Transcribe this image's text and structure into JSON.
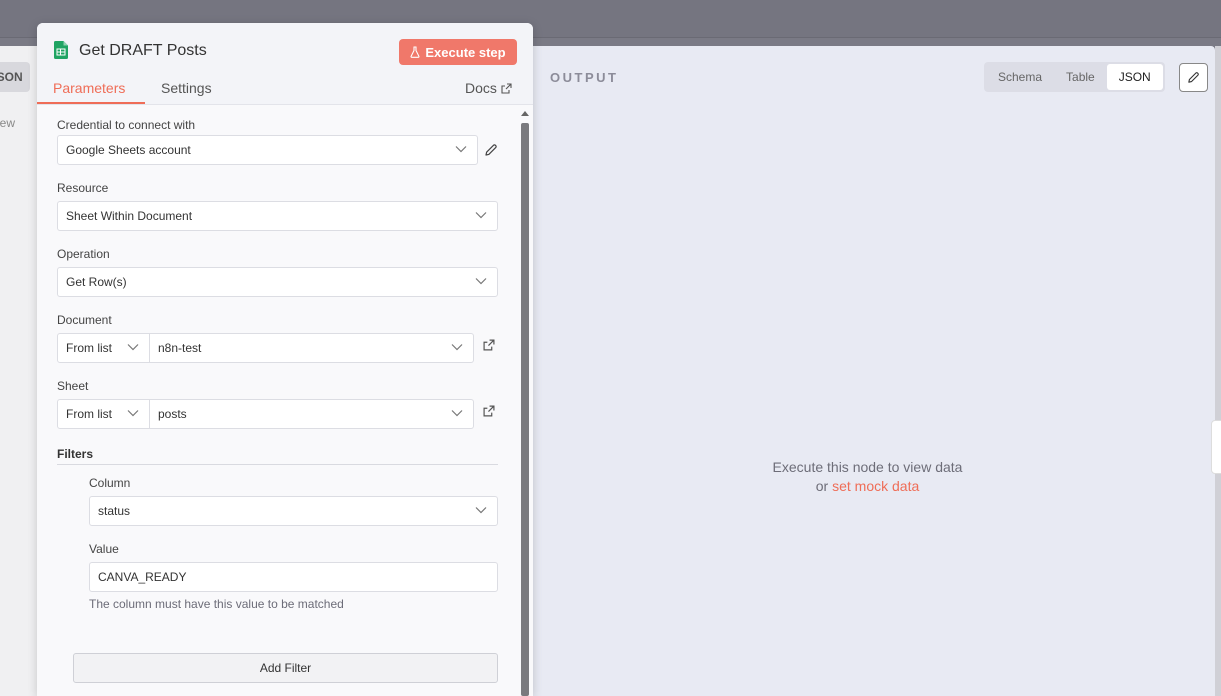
{
  "left_panel": {
    "tab_label": "JSON",
    "text": "view"
  },
  "node": {
    "title": "Get DRAFT Posts",
    "execute_label": "Execute step",
    "tabs": [
      {
        "label": "Parameters",
        "active": true
      },
      {
        "label": "Settings",
        "active": false
      }
    ],
    "docs_label": "Docs"
  },
  "params": {
    "credential": {
      "label": "Credential to connect with",
      "value": "Google Sheets account"
    },
    "resource": {
      "label": "Resource",
      "value": "Sheet Within Document"
    },
    "operation": {
      "label": "Operation",
      "value": "Get Row(s)"
    },
    "document": {
      "label": "Document",
      "mode": "From list",
      "value": "n8n-test"
    },
    "sheet": {
      "label": "Sheet",
      "mode": "From list",
      "value": "posts"
    },
    "filters": {
      "title": "Filters",
      "column_label": "Column",
      "column_value": "status",
      "value_label": "Value",
      "value_value": "CANVA_READY",
      "hint": "The column must have this value to be matched",
      "add_label": "Add Filter"
    }
  },
  "output": {
    "title": "OUTPUT",
    "views": [
      "Schema",
      "Table",
      "JSON"
    ],
    "active_view": "JSON",
    "empty_line1": "Execute this node to view data",
    "empty_or": "or",
    "empty_link": "set mock data"
  },
  "colors": {
    "accent": "#ef6d57",
    "sheets_green": "#1fa463"
  }
}
